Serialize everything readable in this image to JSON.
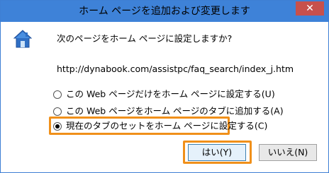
{
  "dialog": {
    "title": "ホーム ページを追加および変更します",
    "close_glyph": "✕",
    "icon": "home-page-icon",
    "question": "次のページをホーム ページに設定しますか?",
    "url": "http://dynabook.com/assistpc/faq_search/index_j.htm",
    "options": [
      {
        "label": "この Web ページだけをホーム ページに設定する(U)",
        "selected": false
      },
      {
        "label": "この Web ページをホーム ページのタブに追加する(A)",
        "selected": false
      },
      {
        "label": "現在のタブのセットをホーム ページに設定する(C)",
        "selected": true
      }
    ],
    "yes_label": "はい(Y)",
    "no_label": "いいえ(N)",
    "colors": {
      "titlebar": "#3e82d8",
      "close_button": "#c7504c",
      "highlight": "#f0901a"
    }
  }
}
